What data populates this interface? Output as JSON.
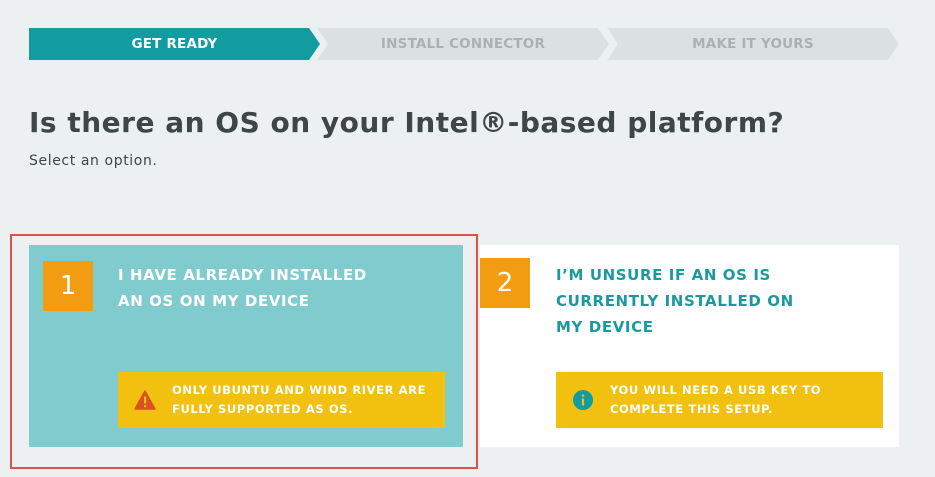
{
  "stepper": {
    "steps": [
      {
        "label": "GET READY",
        "state": "active"
      },
      {
        "label": "INSTALL CONNECTOR",
        "state": "inactive"
      },
      {
        "label": "MAKE IT YOURS",
        "state": "inactive"
      }
    ],
    "active_color": "#139ca0",
    "inactive_color": "#dbe1e1"
  },
  "page": {
    "title": "Is there an OS on your Intel®-based platform?",
    "subtitle": "Select an option."
  },
  "options": [
    {
      "number": "1",
      "title": "I HAVE ALREADY INSTALLED\nAN OS ON MY DEVICE",
      "note": "ONLY UBUNTU AND WIND RIVER ARE\nFULLY SUPPORTED AS OS.",
      "note_icon": "warning-icon",
      "selected": true
    },
    {
      "number": "2",
      "title": "I’M UNSURE IF AN OS IS\nCURRENTLY INSTALLED ON\nMY DEVICE",
      "note": "YOU WILL NEED A USB KEY TO\nCOMPLETE THIS SETUP.",
      "note_icon": "info-icon",
      "selected": false
    }
  ],
  "colors": {
    "accent": "#139ca0",
    "number_badge": "#f29c12",
    "note_bg": "#f2c110",
    "selected_card": "#7fcbcd",
    "highlight_border": "#e0504b"
  }
}
